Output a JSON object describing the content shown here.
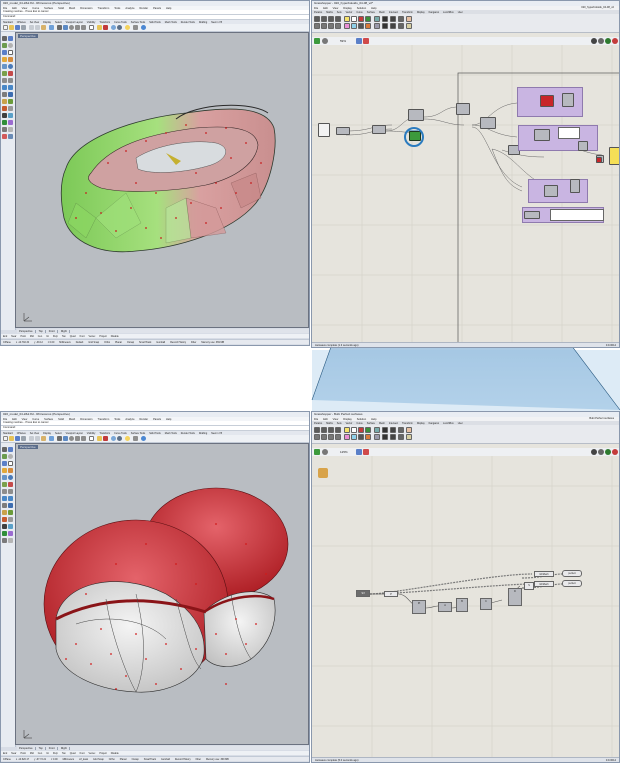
{
  "top": {
    "rhino": {
      "title": "020_model_04-Z&2.8d - Rhinoceros (Perspective)",
      "menus": [
        "File",
        "Edit",
        "View",
        "Curve",
        "Surface",
        "Solid",
        "Mesh",
        "Dimension",
        "Transform",
        "Tools",
        "Analyze",
        "Render",
        "Panels",
        "Help"
      ],
      "command_lines": [
        "Creating meshes... Press Esc to cancel",
        "Command:"
      ],
      "toolbar_tabs": [
        "Standard",
        "CPlanes",
        "Set View",
        "Display",
        "Select",
        "Viewport Layout",
        "Visibility",
        "Transform",
        "Curve Tools",
        "Surface Tools",
        "Solid Tools",
        "Mesh Tools",
        "Render Tools",
        "Drafting",
        "New in V5"
      ],
      "viewport_label": "Perspective",
      "viewport_tabs": [
        "Perspective",
        "Top",
        "Front",
        "Right"
      ],
      "snaps": [
        "End",
        "Near",
        "Point",
        "Mid",
        "Cen",
        "Int",
        "Perp",
        "Tan",
        "Quad",
        "Knot",
        "Vertex",
        "Project",
        "Disable"
      ],
      "status": [
        "CPlane",
        "x -10.792.34",
        "y -39.12",
        "z 0.00",
        "Millimeters",
        "Default",
        "Grid Snap",
        "Ortho",
        "Planar",
        "Osnap",
        "SmartTrack",
        "Gumball",
        "Record History",
        "Filter",
        "Memory use: 369 MB"
      ]
    },
    "grasshopper": {
      "title": "Grasshopper - 020_hyperboloids_04-08_v2*",
      "file_label": "020_hyperboloids_04-08_v2",
      "menus": [
        "File",
        "Edit",
        "View",
        "Display",
        "Solution",
        "Help"
      ],
      "tabs": [
        "Params",
        "Maths",
        "Sets",
        "Vector",
        "Curve",
        "Surface",
        "Mesh",
        "Intersect",
        "Transform",
        "Display",
        "Kangaroo",
        "LunchBox",
        "User"
      ],
      "zoom": "59%",
      "status": "Autosave complete (1.3 seconds ago)",
      "version": "0.9.0014"
    }
  },
  "bottom": {
    "rhino": {
      "title": "020_model_04-Z&2.8d - Rhinoceros (Perspective)",
      "menus": [
        "File",
        "Edit",
        "View",
        "Curve",
        "Surface",
        "Solid",
        "Mesh",
        "Dimension",
        "Transform",
        "Tools",
        "Analyze",
        "Render",
        "Panels",
        "Help"
      ],
      "command_lines": [
        "Creating meshes... Press Esc to cancel",
        "Command:"
      ],
      "toolbar_tabs": [
        "Standard",
        "CPlanes",
        "Set View",
        "Display",
        "Select",
        "Viewport Layout",
        "Visibility",
        "Transform",
        "Curve Tools",
        "Surface Tools",
        "Solid Tools",
        "Mesh Tools",
        "Render Tools",
        "Drafting",
        "New in V5"
      ],
      "viewport_label": "Perspective",
      "viewport_tabs": [
        "Perspective",
        "Top",
        "Front",
        "Right"
      ],
      "snaps": [
        "End",
        "Near",
        "Point",
        "Mid",
        "Cen",
        "Int",
        "Perp",
        "Tan",
        "Quad",
        "Knot",
        "Vertex",
        "Project",
        "Disable"
      ],
      "status": [
        "CPlane",
        "x -10.620.17",
        "y -67.72.21",
        "z 0.00",
        "Millimeters",
        "srf_kask",
        "Grid Snap",
        "Ortho",
        "Planar",
        "Osnap",
        "SmartTrack",
        "Gumball",
        "Record History",
        "Filter",
        "Memory use: 369 MB"
      ]
    },
    "grasshopper": {
      "title": "Grasshopper - Bubi Perfect surfaces",
      "file_label": "Bubi Perfect surfaces",
      "menus": [
        "File",
        "Edit",
        "View",
        "Display",
        "Solution",
        "Help"
      ],
      "tabs": [
        "Params",
        "Maths",
        "Sets",
        "Vector",
        "Curve",
        "Surface",
        "Mesh",
        "Intersect",
        "Transform",
        "Display",
        "Kangaroo",
        "LunchBox",
        "User"
      ],
      "zoom": "125%",
      "status": "Autosave complete (5.0 seconds ago)",
      "version": "0.9.0014",
      "node_labels": [
        "Srf",
        "P",
        "Pt",
        "A",
        "B",
        "C",
        "D",
        "S",
        "GFMesh",
        "GFMesh",
        "perfect",
        "perfect"
      ]
    }
  },
  "colors": {
    "shell_green": "#8fd66a",
    "shell_pink": "#d89a9a",
    "shell_red": "#c8262a",
    "shell_white": "#e6e6e6",
    "gh_canvas": "#e6e4dd",
    "group_purple": "#c9b5e2",
    "zoom_blue": "#4a8ec9"
  },
  "icons": [
    "window-minimize-icon",
    "window-maximize-icon",
    "window-close-icon",
    "grasshopper-logo-icon",
    "zoom-icon",
    "preview-icon"
  ]
}
